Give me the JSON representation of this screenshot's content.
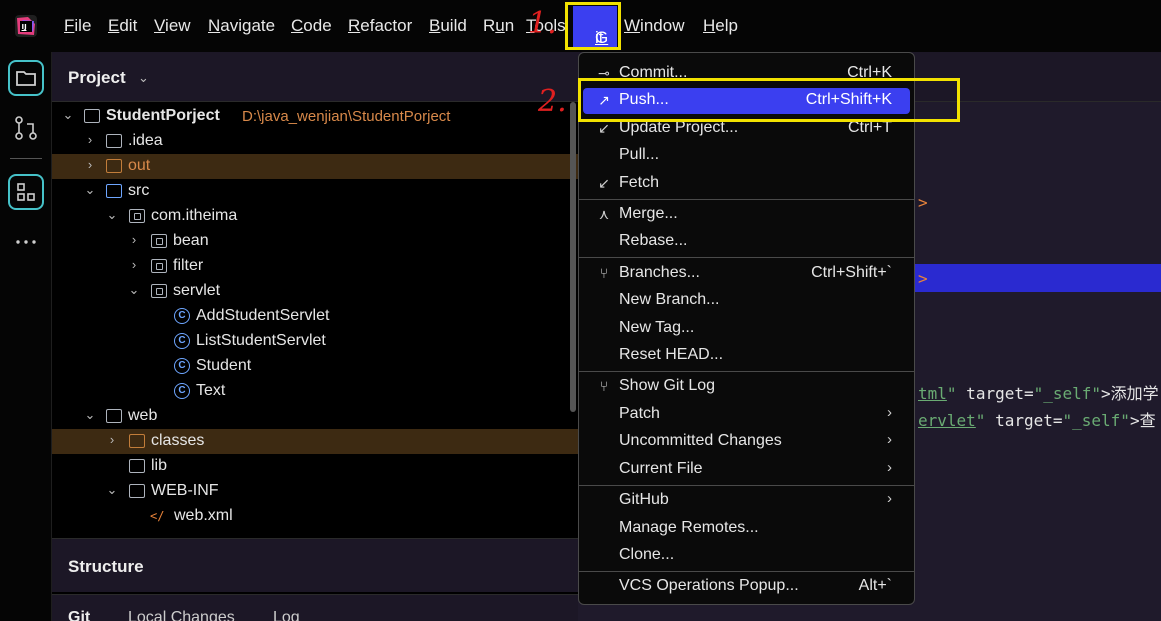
{
  "menubar": {
    "items": [
      {
        "label": "File",
        "mn": "F",
        "rest": "ile"
      },
      {
        "label": "Edit",
        "mn": "E",
        "rest": "dit"
      },
      {
        "label": "View",
        "mn": "V",
        "rest": "iew"
      },
      {
        "label": "Navigate",
        "mn": "N",
        "rest": "avigate"
      },
      {
        "label": "Code",
        "mn": "C",
        "rest": "ode"
      },
      {
        "label": "Refactor",
        "mn": "R",
        "rest": "efactor"
      },
      {
        "label": "Build",
        "mn": "B",
        "rest": "uild"
      },
      {
        "label": "Run",
        "pre": "R",
        "mn": "u",
        "rest": "n"
      },
      {
        "label": "Tools",
        "mn": "T",
        "rest": "ools"
      },
      {
        "label": "Git",
        "mn": "G",
        "rest": "it"
      },
      {
        "label": "Window",
        "mn": "W",
        "rest": "indow"
      },
      {
        "label": "Help",
        "mn": "H",
        "rest": "elp"
      }
    ]
  },
  "project": {
    "title": "Project",
    "tree": [
      {
        "label": "StudentPorject",
        "path": "D:\\java_wenjian\\StudentPorject"
      },
      {
        "label": ".idea"
      },
      {
        "label": "out"
      },
      {
        "label": "src"
      },
      {
        "label": "com.itheima"
      },
      {
        "label": "bean"
      },
      {
        "label": "filter"
      },
      {
        "label": "servlet"
      },
      {
        "label": "AddStudentServlet"
      },
      {
        "label": "ListStudentServlet"
      },
      {
        "label": "Student"
      },
      {
        "label": "Text"
      },
      {
        "label": "web"
      },
      {
        "label": "classes"
      },
      {
        "label": "lib"
      },
      {
        "label": "WEB-INF"
      },
      {
        "label": "web.xml"
      }
    ]
  },
  "structure": {
    "title": "Structure"
  },
  "git_panel": {
    "tabs": [
      "Git",
      "Local Changes",
      "Log"
    ]
  },
  "editor": {
    "line1_tag": ">",
    "line2_tag": ">",
    "line3_link": "tml",
    "line3_attr": " target=",
    "line3_val": "\"_self\"",
    "line3_text": ">添加学",
    "line4_link": "ervlet",
    "line4_attr": " target=",
    "line4_val": "\"_self\"",
    "line4_text": ">查",
    "line3_q": "\""
  },
  "git_menu": {
    "items": [
      {
        "label": "Commit...",
        "shortcut": "Ctrl+K"
      },
      {
        "label": "Push...",
        "shortcut": "Ctrl+Shift+K"
      },
      {
        "label": "Update Project...",
        "shortcut": "Ctrl+T"
      },
      {
        "label": "Pull...",
        "shortcut": ""
      },
      {
        "label": "Fetch",
        "shortcut": ""
      },
      {
        "label": "Merge...",
        "shortcut": ""
      },
      {
        "label": "Rebase...",
        "shortcut": ""
      },
      {
        "label": "Branches...",
        "shortcut": "Ctrl+Shift+`"
      },
      {
        "label": "New Branch...",
        "shortcut": ""
      },
      {
        "label": "New Tag...",
        "shortcut": ""
      },
      {
        "label": "Reset HEAD...",
        "shortcut": ""
      },
      {
        "label": "Show Git Log",
        "shortcut": ""
      },
      {
        "label": "Patch",
        "shortcut": ""
      },
      {
        "label": "Uncommitted Changes",
        "shortcut": ""
      },
      {
        "label": "Current File",
        "shortcut": ""
      },
      {
        "label": "GitHub",
        "shortcut": ""
      },
      {
        "label": "Manage Remotes...",
        "shortcut": ""
      },
      {
        "label": "Clone...",
        "shortcut": ""
      },
      {
        "label": "VCS Operations Popup...",
        "shortcut": "Alt+`"
      }
    ]
  },
  "annotations": {
    "step1": "1.",
    "step2": "2."
  },
  "colors": {
    "accent": "#3b3ff0",
    "highlight_box": "#f2e200",
    "annotation": "#e02020",
    "folder_excluded": "#d8894a"
  }
}
